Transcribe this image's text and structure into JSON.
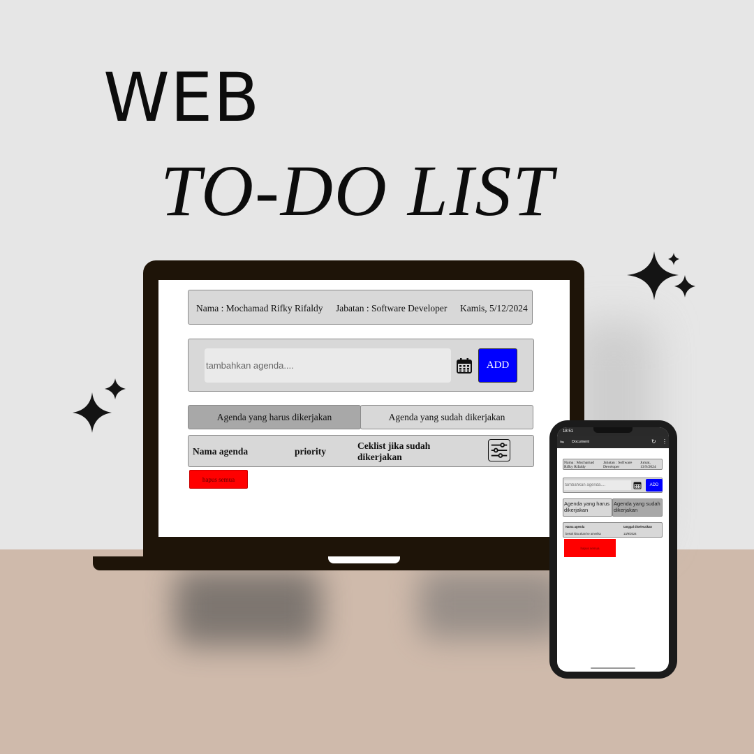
{
  "headline": {
    "line1": "WEB",
    "line2": "TO-DO LIST"
  },
  "laptop_app": {
    "info": {
      "name": "Nama : Mochamad Rifky Rifaldy",
      "position": "Jabatan : Software Developer",
      "date": "Kamis, 5/12/2024"
    },
    "input": {
      "placeholder": "tambahkan agenda....",
      "value": ""
    },
    "add_label": "ADD",
    "tabs": [
      "Agenda yang harus dikerjakan",
      "Agenda yang sudah dikerjakan"
    ],
    "columns": [
      "Nama agenda",
      "priority",
      "Ceklist jika sudah dikerjakan"
    ],
    "delete_label": "hapus semua"
  },
  "phone_app": {
    "status_time": "18:51",
    "browser_title": "Document",
    "info": {
      "name": "Nama : Mochamad Rifky Rifaldy",
      "position": "Jabatan : Software Developer",
      "date": "Jumat, 13/9/2024"
    },
    "input": {
      "placeholder": "tambahkan agenda....",
      "value": ""
    },
    "add_label": "ADD",
    "tabs": [
      "Agenda yang harus dikerjakan",
      "Agenda yang sudah dikerjakan"
    ],
    "columns": [
      "Nama agenda",
      "tanggal diselesaikan"
    ],
    "rows": [
      {
        "agenda": "besok kita akan ke amerika",
        "date": "13/9/2024"
      }
    ],
    "delete_label": "hapus semua"
  },
  "colors": {
    "background": "#e6e6e6",
    "floor": "#cfbaab",
    "device_frame": "#1e1408",
    "add_button": "#0000ff",
    "delete_button": "#ff0000",
    "active_tab": "#a8a8a8",
    "panel": "#d8d8d8"
  },
  "icons": {
    "calendar": "calendar-icon",
    "filter": "sliders-icon",
    "sparkle": "sparkle-icon"
  }
}
